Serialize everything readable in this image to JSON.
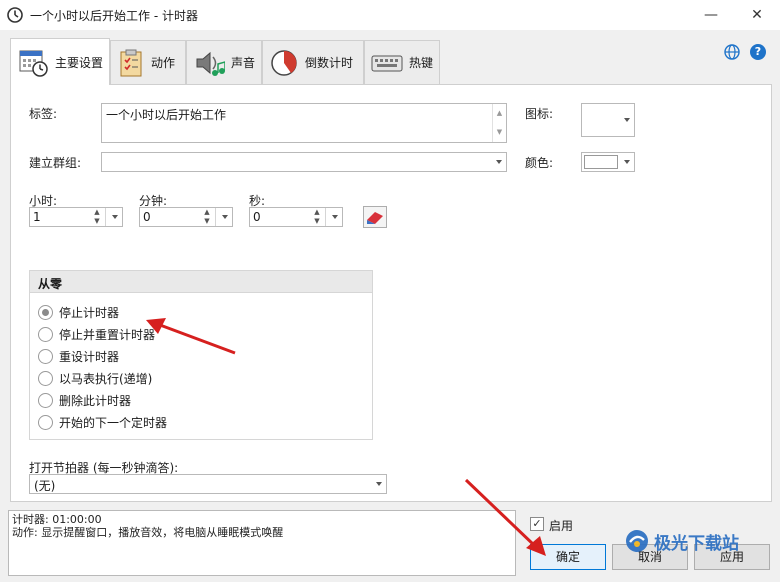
{
  "window": {
    "title": "一个小时以后开始工作 - 计时器",
    "minimize": "—",
    "maximize": "☐",
    "close": "✕"
  },
  "tabs": [
    {
      "label": "主要设置",
      "icon": "calendar-clock-icon",
      "active": true
    },
    {
      "label": "动作",
      "icon": "clipboard-checklist-icon",
      "active": false
    },
    {
      "label": "声音",
      "icon": "speaker-music-icon",
      "active": false
    },
    {
      "label": "倒数计时",
      "icon": "countdown-pie-icon",
      "active": false
    },
    {
      "label": "热键",
      "icon": "keyboard-icon",
      "active": false
    }
  ],
  "help_label": "?",
  "form": {
    "label_caption": "标签:",
    "label_value": "一个小时以后开始工作",
    "icon_caption": "图标:",
    "group_caption": "建立群组:",
    "group_value": "",
    "color_caption": "颜色:",
    "hours_caption": "小时:",
    "hours_value": "1",
    "minutes_caption": "分钟:",
    "minutes_value": "0",
    "seconds_caption": "秒:",
    "seconds_value": "0",
    "spin_up": "▲",
    "spin_down": "▼"
  },
  "from_zero": {
    "title": "从零",
    "options": [
      {
        "label": "停止计时器",
        "selected": true
      },
      {
        "label": "停止并重置计时器",
        "selected": false
      },
      {
        "label": "重设计时器",
        "selected": false
      },
      {
        "label": "以马表执行(递增)",
        "selected": false
      },
      {
        "label": "删除此计时器",
        "selected": false
      },
      {
        "label": "开始的下一个定时器",
        "selected": false
      }
    ]
  },
  "metronome": {
    "caption": "打开节拍器 (每一秒钟滴答):",
    "value": "(无)"
  },
  "status": {
    "line1": "计时器: 01:00:00",
    "line2": "动作: 显示提醒窗口，播放音效，将电脑从睡眠模式唤醒"
  },
  "enable": {
    "label": "启用",
    "checked": true,
    "mark": "✓"
  },
  "buttons": {
    "ok": "确定",
    "cancel": "取消",
    "apply": "应用"
  },
  "watermark": "极光下载站",
  "colors": {
    "accent": "#0078d7",
    "arrow": "#d6201f",
    "panel_bg": "#f0f0f0"
  }
}
